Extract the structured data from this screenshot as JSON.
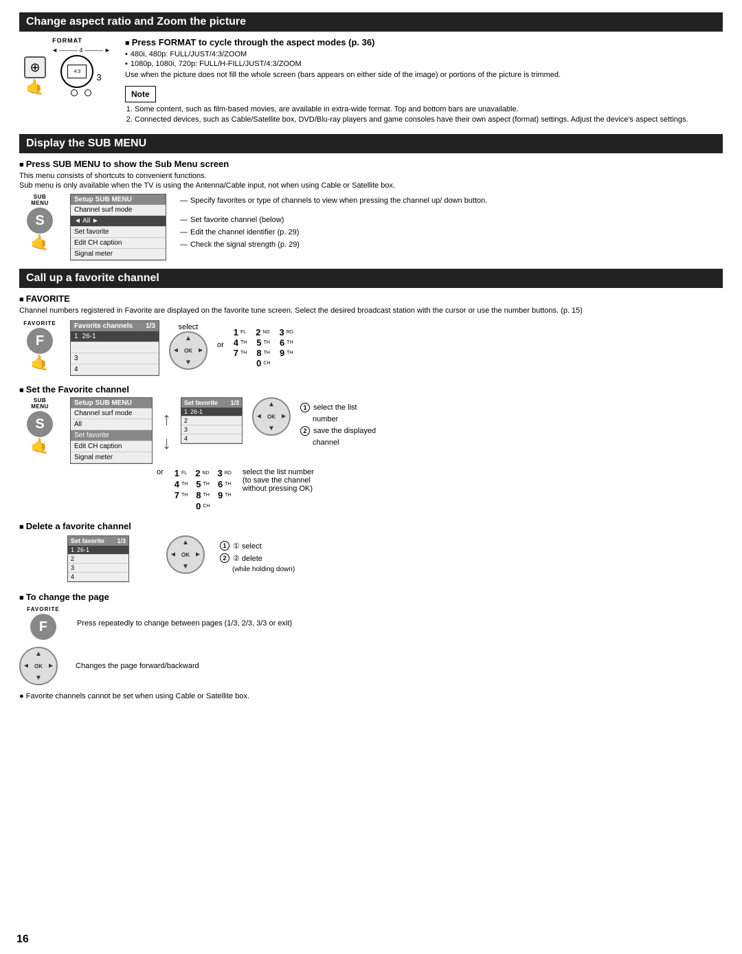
{
  "page_number": "16",
  "sections": [
    {
      "id": "change-aspect",
      "title": "Change aspect ratio and Zoom the picture",
      "subsections": [
        {
          "id": "press-format",
          "title": "Press FORMAT to cycle through the aspect modes",
          "title_ref": "(p. 36)",
          "format_label": "FORMAT",
          "bullets": [
            "480i, 480p: FULL/JUST/4:3/ZOOM",
            "1080p, 1080i, 720p: FULL/H-FILL/JUST/4:3/ZOOM"
          ],
          "description": "Use when the picture does not fill the whole screen (bars appears on either side of the image) or portions of the picture is trimmed.",
          "note_label": "Note",
          "notes": [
            "Some content, such as film-based movies, are available in extra-wide format. Top and bottom bars are unavailable.",
            "Connected devices, such as Cable/Satellite box, DVD/Blu-ray players and game consoles have their own aspect (format) settings. Adjust the device's aspect settings."
          ],
          "aspect_label": "4:3",
          "aspect_number": "3"
        }
      ]
    },
    {
      "id": "display-sub-menu",
      "title": "Display the SUB MENU",
      "subsections": [
        {
          "id": "press-sub-menu",
          "title": "Press SUB MENU to show the Sub Menu screen",
          "description1": "This menu consists of shortcuts to convenient functions.",
          "description2": "Sub menu is only available when the TV is using the Antenna/Cable input, not when using Cable or Satellite box.",
          "sub_label": "SUB\nMENU",
          "screen_title": "Setup SUB MENU",
          "menu_items": [
            {
              "label": "Channel surf mode",
              "selected": false
            },
            {
              "label": "◄  All  ►",
              "selected": true
            },
            {
              "label": "Set favorite",
              "selected": false
            },
            {
              "label": "Edit CH caption",
              "selected": false
            },
            {
              "label": "Signal meter",
              "selected": false
            }
          ],
          "callouts": [
            "Specify favorites or type of channels to view when pressing the channel up/\ndown button.",
            "Set favorite channel (below)",
            "Edit the channel identifier (p. 29)",
            "Check the signal strength (p. 29)"
          ]
        }
      ]
    },
    {
      "id": "call-up-favorite",
      "title": "Call up a favorite channel",
      "subsections": [
        {
          "id": "favorite",
          "title": "FAVORITE",
          "description": "Channel numbers registered in Favorite are displayed on the favorite tune screen. Select the desired broadcast station with the cursor or use the number buttons. (p. 15)",
          "fav_label": "FAVORITE",
          "fav_screen_title": "Favorite channels",
          "fav_page": "1/3",
          "fav_items": [
            {
              "num": "1",
              "ch": "26-1",
              "selected": true
            },
            {
              "num": "",
              "ch": "",
              "selected": false
            },
            {
              "num": "3",
              "ch": "",
              "selected": false
            },
            {
              "num": "4",
              "ch": "",
              "selected": false
            }
          ],
          "select_label": "select",
          "or_label": "or",
          "num_buttons": [
            [
              "1",
              "FL",
              "2",
              "ND",
              "3",
              "RD"
            ],
            [
              "4",
              "TH",
              "5",
              "TH",
              "6",
              "TH"
            ],
            [
              "7",
              "TH",
              "8",
              "TH",
              "9",
              "TH"
            ],
            [
              "0",
              "CH"
            ]
          ]
        },
        {
          "id": "set-favorite",
          "title": "Set the Favorite channel",
          "sub_label": "SUB\nMENU",
          "setup_title": "Setup SUB MENU",
          "setup_items": [
            {
              "label": "Channel surf mode"
            },
            {
              "label": "All"
            },
            {
              "label": "Set favorite",
              "highlight": true
            },
            {
              "label": "Edit CH caption"
            },
            {
              "label": "Signal meter"
            }
          ],
          "set_fav_title": "Set favorite",
          "set_fav_page": "1/3",
          "set_fav_items": [
            {
              "num": "1",
              "ch": "26-1",
              "selected": true
            },
            {
              "num": "2",
              "ch": ""
            },
            {
              "num": "3",
              "ch": ""
            },
            {
              "num": "4",
              "ch": ""
            }
          ],
          "step1_label": "① select the list number",
          "step2_label": "② save the displayed channel",
          "or_label": "or",
          "num_label": "select the list number",
          "save_label": "(to save the channel without pressing OK)",
          "num_buttons2": [
            [
              "1",
              "FL",
              "2",
              "ND",
              "3",
              "RD"
            ],
            [
              "4",
              "TH",
              "5",
              "TH",
              "6",
              "TH"
            ],
            [
              "7",
              "TH",
              "8",
              "TH",
              "9",
              "TH"
            ],
            [
              "0",
              "CH"
            ]
          ]
        },
        {
          "id": "delete-favorite",
          "title": "Delete a favorite channel",
          "del_fav_title": "Set favorite",
          "del_fav_page": "1/3",
          "del_fav_items": [
            {
              "num": "1",
              "ch": "26-1",
              "selected": true
            },
            {
              "num": "2",
              "ch": ""
            },
            {
              "num": "3",
              "ch": ""
            },
            {
              "num": "4",
              "ch": ""
            }
          ],
          "step1_label": "① select",
          "step2_label": "② delete",
          "step2_sub": "(while holding down)"
        },
        {
          "id": "change-page",
          "title": "To change the page",
          "fav_label2": "FAVORITE",
          "f_label": "F",
          "press_text": "Press repeatedly to change between pages (1/3, 2/3, 3/3 or exit)",
          "changes_text": "Changes the page forward/backward"
        }
      ]
    }
  ],
  "bottom_note": "● Favorite channels cannot be set when using Cable or Satellite box."
}
